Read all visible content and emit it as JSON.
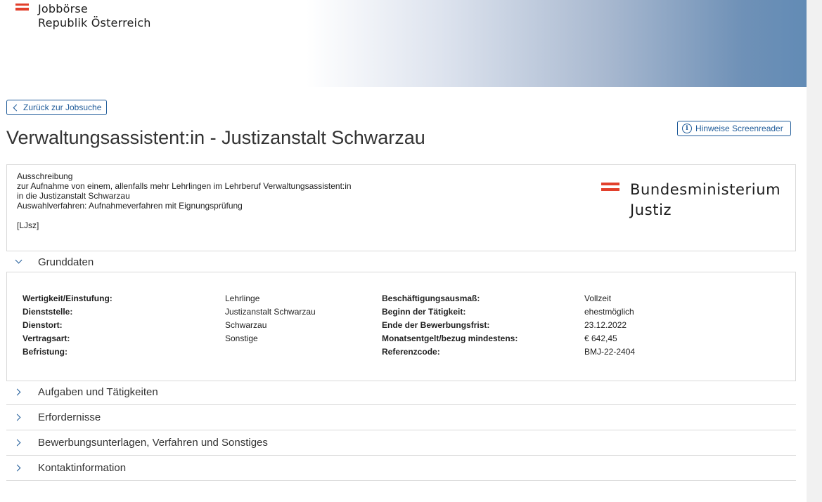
{
  "header": {
    "brand_line1": "Jobbörse",
    "brand_line2": "Republik Österreich"
  },
  "nav": {
    "back_label": "Zurück zur Jobsuche",
    "screenreader_label": "Hinweise Screenreader"
  },
  "job": {
    "title": "Verwaltungsassistent:in - Justizanstalt Schwarzau",
    "description": [
      "Ausschreibung",
      "zur Aufnahme von einem, allenfalls mehr Lehrlingen im Lehrberuf Verwaltungsassistent:in",
      "in die Justizanstalt Schwarzau",
      "Auswahlverfahren: Aufnahmeverfahren mit Eignungsprüfung",
      "",
      "[LJsz]"
    ],
    "ministry_line1": "Bundesministerium",
    "ministry_line2": "Justiz"
  },
  "grunddaten": {
    "label": "Grunddaten",
    "left_labels": [
      "Wertigkeit/Einstufung:",
      "Dienststelle:",
      "Dienstort:",
      "Vertragsart:",
      "Befristung:"
    ],
    "left_values": [
      "Lehrlinge",
      "Justizanstalt Schwarzau",
      "Schwarzau",
      "Sonstige",
      ""
    ],
    "right_labels": [
      "Beschäftigungsausmaß:",
      "Beginn der Tätigkeit:",
      "Ende der Bewerbungsfrist:",
      "Monatsentgelt/bezug mindestens:",
      "Referenzcode:"
    ],
    "right_values": [
      "Vollzeit",
      "ehestmöglich",
      "23.12.2022",
      "€ 642,45",
      "BMJ-22-2404"
    ]
  },
  "sections": [
    "Aufgaben und Tätigkeiten",
    "Erfordernisse",
    "Bewerbungsunterlagen, Verfahren und Sonstiges",
    "Kontaktinformation"
  ],
  "colors": {
    "accent": "#1f5b99",
    "flag_red": "#e2402c",
    "header_gradient_end": "#628bb5"
  }
}
